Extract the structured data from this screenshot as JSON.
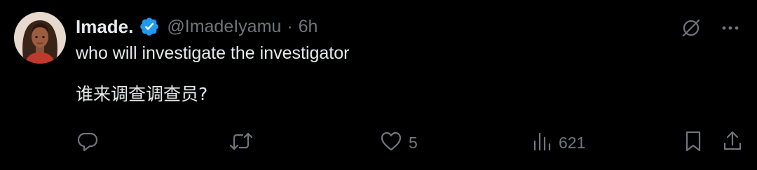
{
  "author": {
    "display_name": "Imade.",
    "handle": "@ImadeIyamu",
    "separator": "·",
    "time": "6h",
    "verified": true,
    "verified_color": "#1d9bf0"
  },
  "tweet": {
    "line1": "who will investigate the investigator",
    "line2": "谁来调查调查员?"
  },
  "actions": {
    "reply": {
      "icon": "reply-icon",
      "count": ""
    },
    "retweet": {
      "icon": "retweet-icon",
      "count": ""
    },
    "like": {
      "icon": "heart-icon",
      "count": "5"
    },
    "views": {
      "icon": "views-icon",
      "count": "621"
    },
    "bookmark": {
      "icon": "bookmark-icon"
    },
    "share": {
      "icon": "share-icon"
    }
  },
  "top_icons": {
    "grok": "grok-icon",
    "more": "more-icon"
  },
  "colors": {
    "background": "#000000",
    "text": "#e7e9ea",
    "muted": "#71767b",
    "accent": "#1d9bf0"
  }
}
